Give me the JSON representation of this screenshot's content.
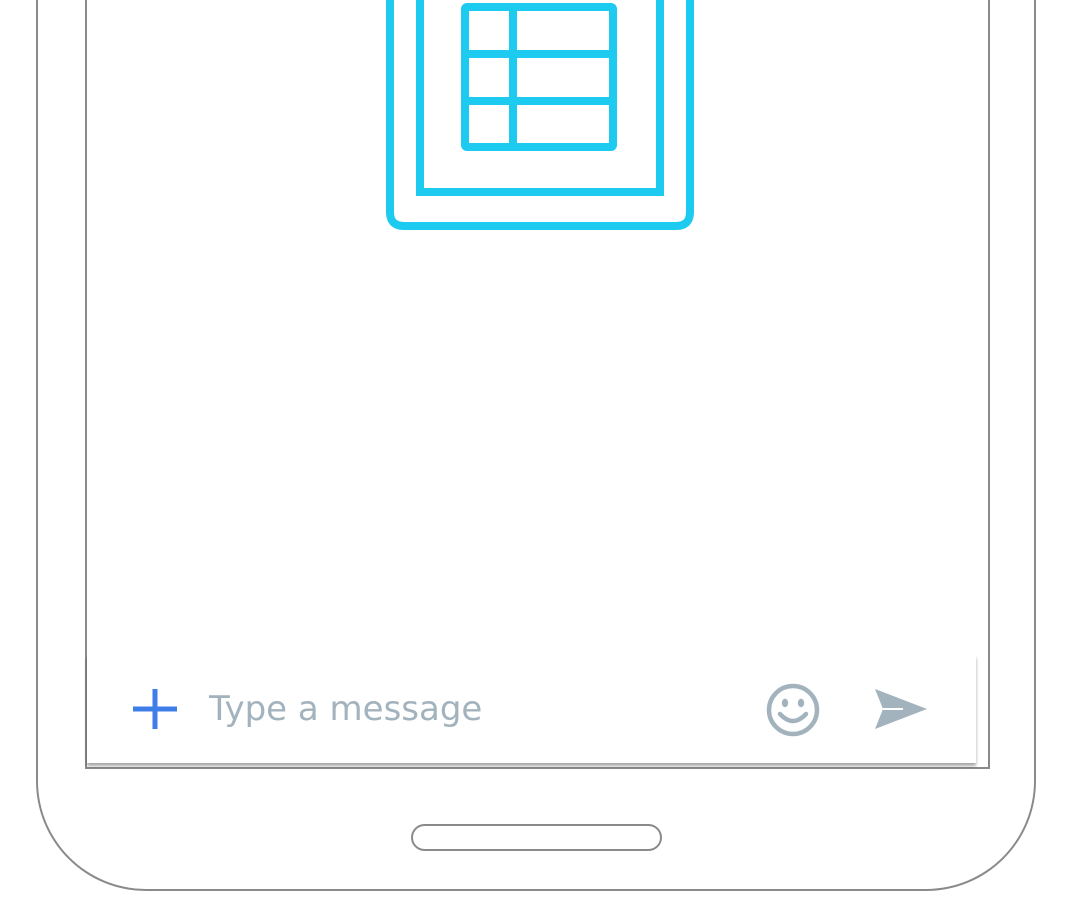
{
  "composer": {
    "placeholder": "Type a message",
    "value": "",
    "add_icon": "plus-icon",
    "emoji_icon": "smiley-icon",
    "send_icon": "send-icon"
  },
  "app_icon": {
    "icon": "spreadsheet-icon"
  },
  "colors": {
    "accent_blue": "#3f7de8",
    "icon_cyan": "#1ccbef",
    "muted_gray": "#a3b3be",
    "frame_gray": "#8a8a8a"
  }
}
